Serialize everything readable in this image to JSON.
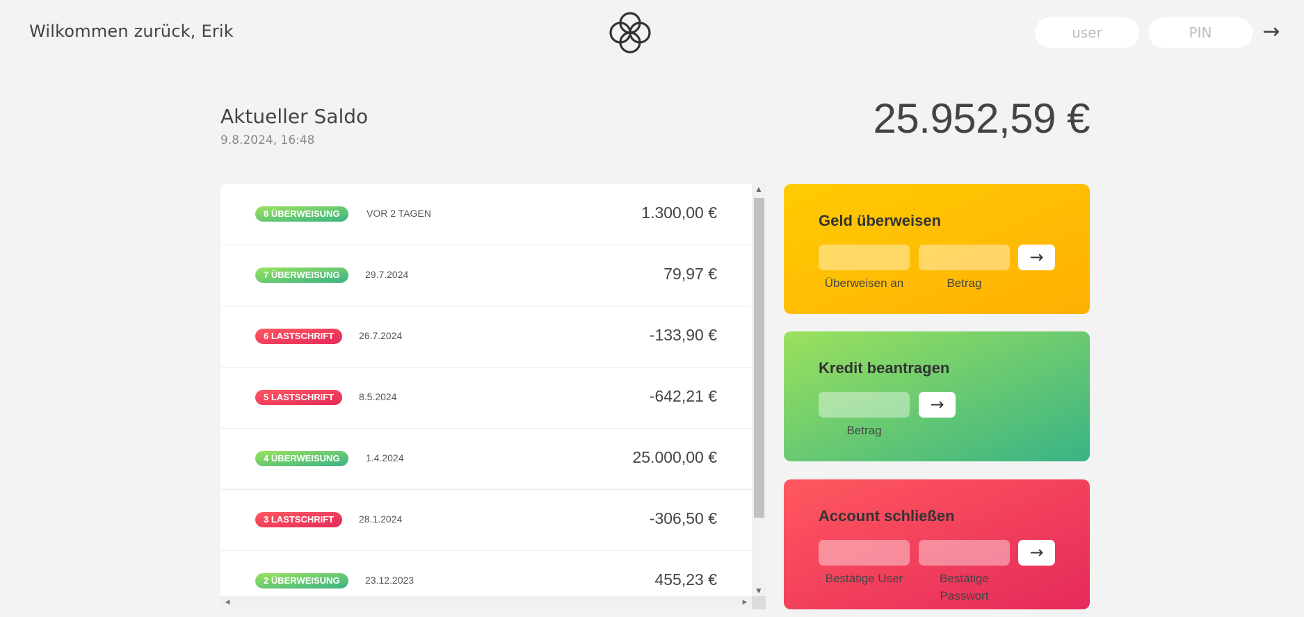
{
  "nav": {
    "welcome": "Wilkommen zurück, Erik",
    "login_user_placeholder": "user",
    "login_pin_placeholder": "PIN",
    "login_button": "→"
  },
  "balance": {
    "label": "Aktueller Saldo",
    "date": "9.8.2024, 16:48",
    "value": "25.952,59 €"
  },
  "movements": [
    {
      "type": "deposit",
      "badge": "8 Überweisung",
      "date": "vor 2 Tagen",
      "value": "1.300,00 €"
    },
    {
      "type": "deposit",
      "badge": "7 Überweisung",
      "date": "29.7.2024",
      "value": "79,97 €"
    },
    {
      "type": "withdrawal",
      "badge": "6 Lastschrift",
      "date": "26.7.2024",
      "value": "-133,90 €"
    },
    {
      "type": "withdrawal",
      "badge": "5 Lastschrift",
      "date": "8.5.2024",
      "value": "-642,21 €"
    },
    {
      "type": "deposit",
      "badge": "4 Überweisung",
      "date": "1.4.2024",
      "value": "25.000,00 €"
    },
    {
      "type": "withdrawal",
      "badge": "3 Lastschrift",
      "date": "28.1.2024",
      "value": "-306,50 €"
    },
    {
      "type": "deposit",
      "badge": "2 Überweisung",
      "date": "23.12.2023",
      "value": "455,23 €"
    }
  ],
  "operations": {
    "transfer": {
      "title": "Geld überweisen",
      "to_label": "Überweisen an",
      "amount_label": "Betrag",
      "button": "→"
    },
    "loan": {
      "title": "Kredit beantragen",
      "amount_label": "Betrag",
      "button": "→"
    },
    "close": {
      "title": "Account schließen",
      "user_label": "Bestätige User",
      "pin_label": "Bestätige Passwort",
      "button": "→"
    }
  },
  "colors": {
    "background": "#f3f3f3",
    "deposit_gradient": [
      "#39b385",
      "#9be15d"
    ],
    "withdrawal_gradient": [
      "#e52a5a",
      "#ff585f"
    ],
    "transfer_gradient": [
      "#ffb003",
      "#ffcb03"
    ]
  }
}
